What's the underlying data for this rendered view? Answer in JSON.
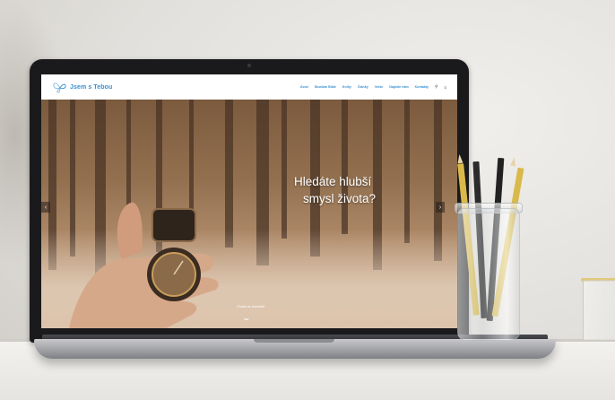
{
  "site": {
    "logo_text": "Jsem s Tebou",
    "menu": [
      "Úvod",
      "Studium Bible",
      "Knihy",
      "Články",
      "Verše",
      "Napište nám",
      "Kontakty"
    ],
    "menu_icons": [
      "search-icon",
      "menu-icon"
    ]
  },
  "hero": {
    "headline_line1": "Hledáte hlubší",
    "headline_line2": "smysl života?",
    "scroll_label": "Chcete se dozvědět"
  },
  "colors": {
    "brand": "#3a8fd0",
    "hero_tint": "#92704f",
    "laptop_bezel": "#1a1a1c"
  }
}
